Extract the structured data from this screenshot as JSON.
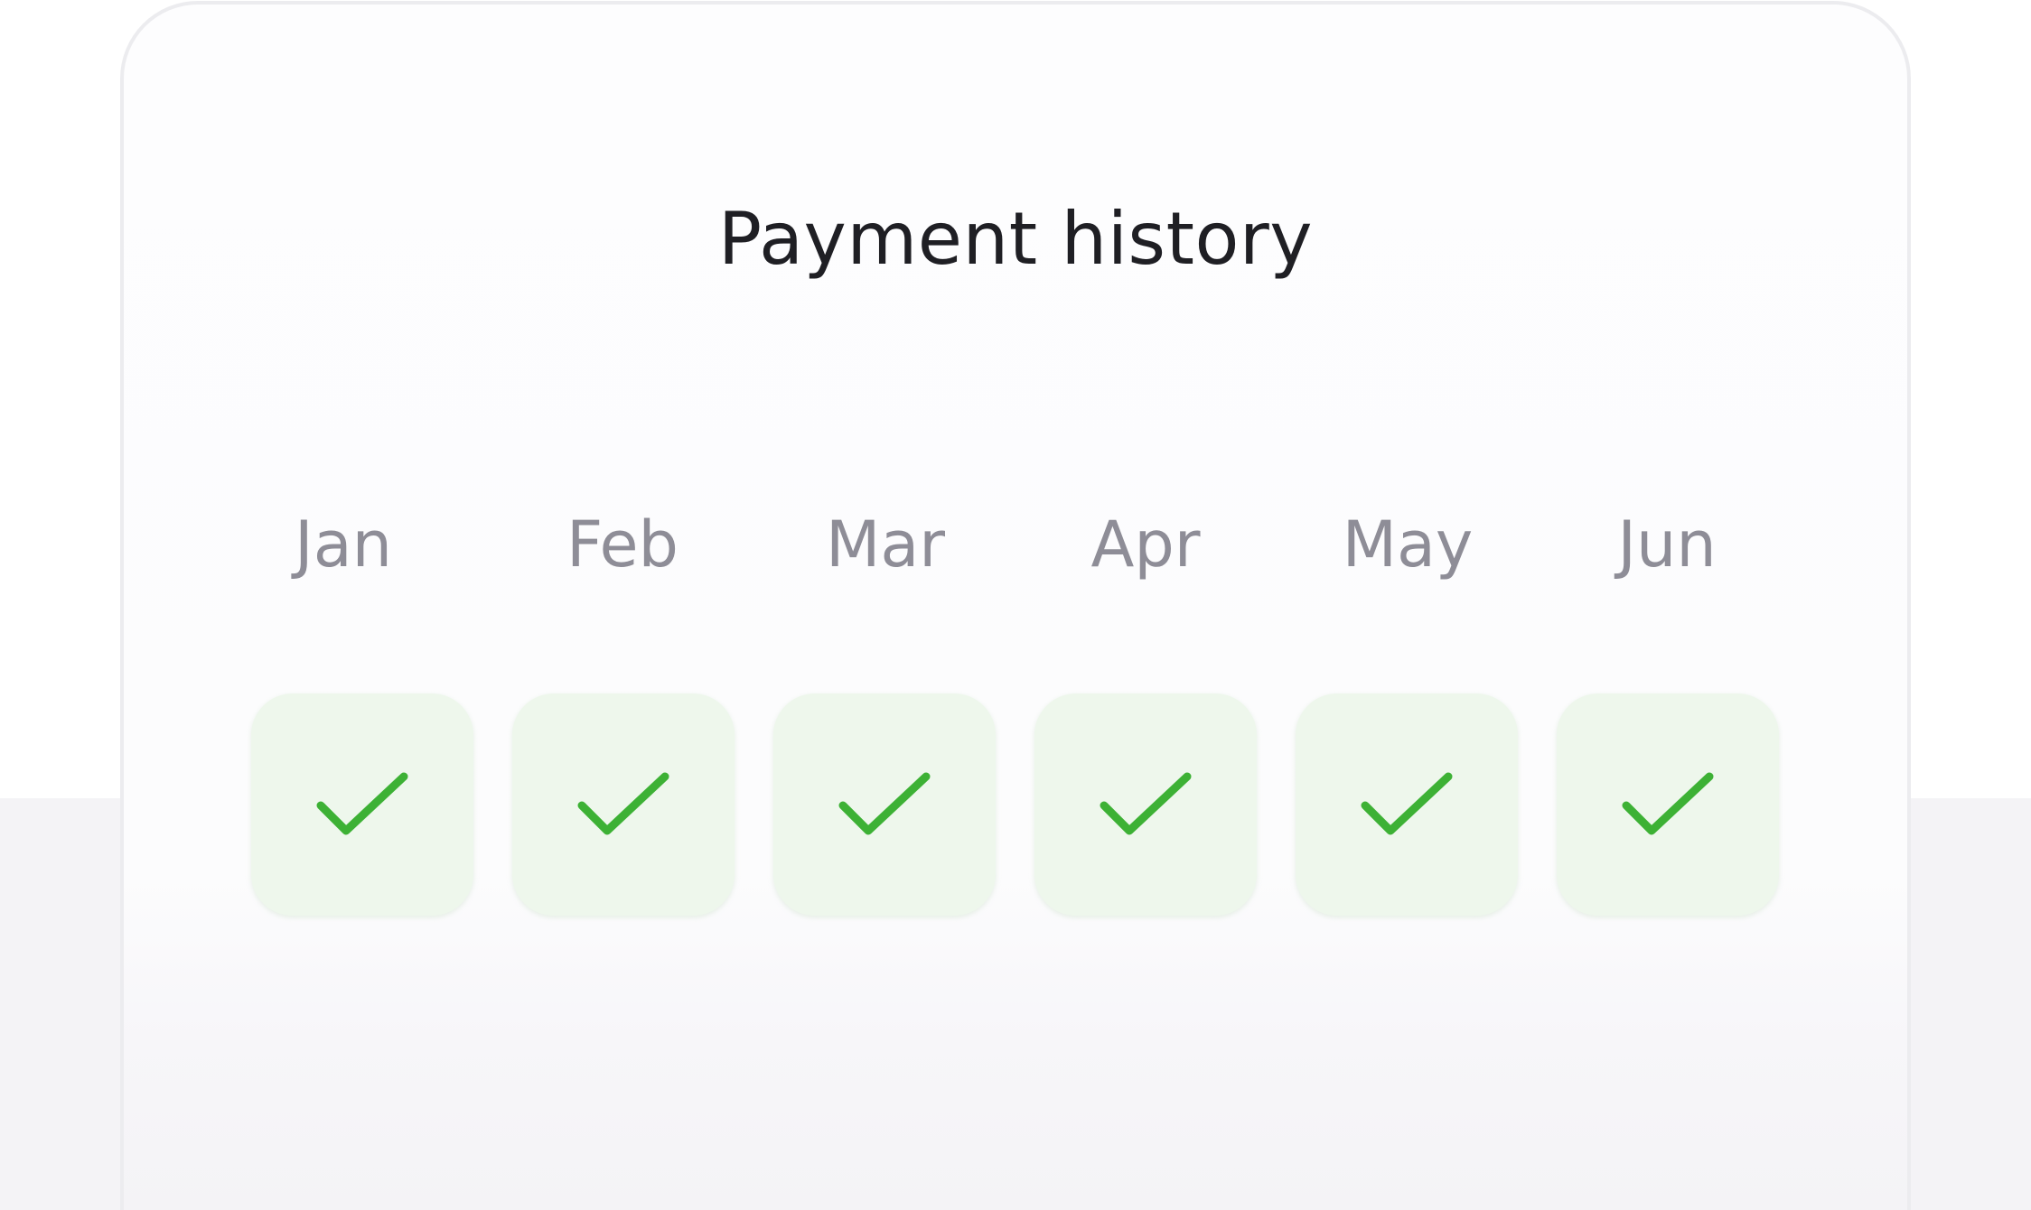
{
  "card": {
    "title": "Payment history"
  },
  "months": [
    {
      "label": "Jan",
      "status": "paid"
    },
    {
      "label": "Feb",
      "status": "paid"
    },
    {
      "label": "Mar",
      "status": "paid"
    },
    {
      "label": "Apr",
      "status": "paid"
    },
    {
      "label": "May",
      "status": "paid"
    },
    {
      "label": "Jun",
      "status": "paid"
    }
  ],
  "colors": {
    "check": "#3db135",
    "tile_background": "#eef7ec",
    "month_text": "#8e8d97",
    "title_text": "#1f1f24"
  },
  "icons": {
    "status": "checkmark-icon"
  }
}
